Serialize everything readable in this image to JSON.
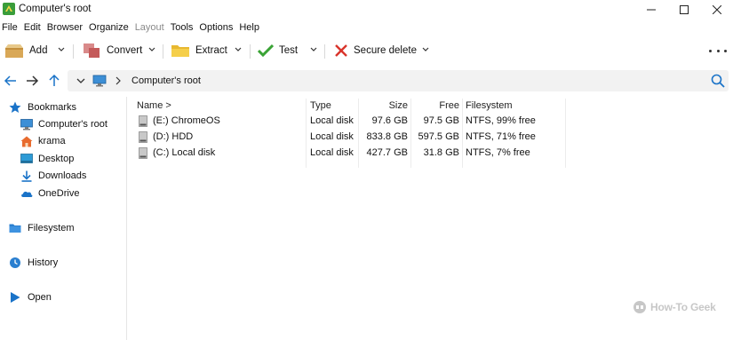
{
  "window": {
    "title": "Computer's root"
  },
  "menu": [
    {
      "label": "File",
      "enabled": true
    },
    {
      "label": "Edit",
      "enabled": true
    },
    {
      "label": "Browser",
      "enabled": true
    },
    {
      "label": "Organize",
      "enabled": true
    },
    {
      "label": "Layout",
      "enabled": false
    },
    {
      "label": "Tools",
      "enabled": true
    },
    {
      "label": "Options",
      "enabled": true
    },
    {
      "label": "Help",
      "enabled": true
    }
  ],
  "toolbar": {
    "add_label": "Add",
    "convert_label": "Convert",
    "extract_label": "Extract",
    "test_label": "Test",
    "secure_delete_label": "Secure delete"
  },
  "address": {
    "path": "Computer's root"
  },
  "sidebar": {
    "bookmarks_label": "Bookmarks",
    "bookmarks": [
      {
        "label": "Computer's root",
        "icon": "monitor-icon"
      },
      {
        "label": "krama",
        "icon": "home-icon"
      },
      {
        "label": "Desktop",
        "icon": "desktop-icon"
      },
      {
        "label": "Downloads",
        "icon": "download-icon"
      },
      {
        "label": "OneDrive",
        "icon": "cloud-icon"
      }
    ],
    "filesystem_label": "Filesystem",
    "history_label": "History",
    "open_label": "Open"
  },
  "file_list": {
    "columns": {
      "name": "Name >",
      "type": "Type",
      "size": "Size",
      "free": "Free",
      "filesystem": "Filesystem"
    },
    "rows": [
      {
        "name": "(E:) ChromeOS",
        "type": "Local disk",
        "size": "97.6 GB",
        "free": "97.5 GB",
        "filesystem": "NTFS, 99% free"
      },
      {
        "name": "(D:) HDD",
        "type": "Local disk",
        "size": "833.8 GB",
        "free": "597.5 GB",
        "filesystem": "NTFS, 71% free"
      },
      {
        "name": "(C:) Local disk",
        "type": "Local disk",
        "size": "427.7 GB",
        "free": "31.8 GB",
        "filesystem": "NTFS, 7% free"
      }
    ]
  },
  "watermark": "How-To Geek",
  "colors": {
    "accent": "#1a73c8",
    "folder": "#f5c542",
    "test_green": "#3aa335",
    "delete_red": "#d9342b"
  }
}
